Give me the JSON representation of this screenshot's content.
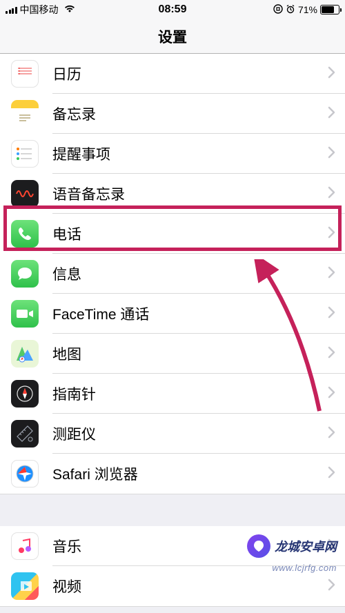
{
  "status": {
    "carrier": "中国移动",
    "time": "08:59",
    "battery_pct": "71%",
    "battery_fill": 71
  },
  "nav": {
    "title": "设置"
  },
  "groups": [
    {
      "items": [
        {
          "id": "calendar",
          "label": "日历",
          "icon": "calendar-icon",
          "bg": "bg-white"
        },
        {
          "id": "notes",
          "label": "备忘录",
          "icon": "notes-icon",
          "bg": "bg-notes"
        },
        {
          "id": "reminders",
          "label": "提醒事项",
          "icon": "reminders-icon",
          "bg": "bg-white"
        },
        {
          "id": "voice-memos",
          "label": "语音备忘录",
          "icon": "voice-memos-icon",
          "bg": "bg-dark"
        },
        {
          "id": "phone",
          "label": "电话",
          "icon": "phone-icon",
          "bg": "bg-green",
          "highlighted": true
        },
        {
          "id": "messages",
          "label": "信息",
          "icon": "messages-icon",
          "bg": "bg-green-msg"
        },
        {
          "id": "facetime",
          "label": "FaceTime 通话",
          "icon": "facetime-icon",
          "bg": "bg-green-ft"
        },
        {
          "id": "maps",
          "label": "地图",
          "icon": "maps-icon",
          "bg": "bg-maps"
        },
        {
          "id": "compass",
          "label": "指南针",
          "icon": "compass-icon",
          "bg": "bg-compass"
        },
        {
          "id": "measure",
          "label": "测距仪",
          "icon": "measure-icon",
          "bg": "bg-measure"
        },
        {
          "id": "safari",
          "label": "Safari 浏览器",
          "icon": "safari-icon",
          "bg": "bg-safari"
        }
      ]
    },
    {
      "items": [
        {
          "id": "music",
          "label": "音乐",
          "icon": "music-icon",
          "bg": "bg-music"
        },
        {
          "id": "videos",
          "label": "视频",
          "icon": "videos-icon",
          "bg": "bg-video"
        }
      ]
    }
  ],
  "annotation": {
    "arrow_color": "#c5215a"
  },
  "watermark": {
    "text": "龙城安卓网",
    "url": "www.lcjrfg.com"
  }
}
